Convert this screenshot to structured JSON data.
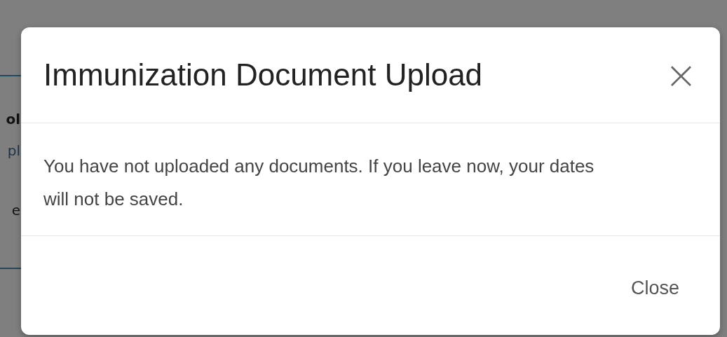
{
  "background_page": {
    "texts": [
      {
        "text": "ol",
        "bold": true
      },
      {
        "text": "pl",
        "bold": false
      },
      {
        "text": "e",
        "bold": false
      }
    ]
  },
  "modal": {
    "title": "Immunization Document Upload",
    "close_icon": "×",
    "message": "You have not uploaded any documents. If you leave now, your dates will not be saved.",
    "buttons": [
      "Close"
    ]
  }
}
